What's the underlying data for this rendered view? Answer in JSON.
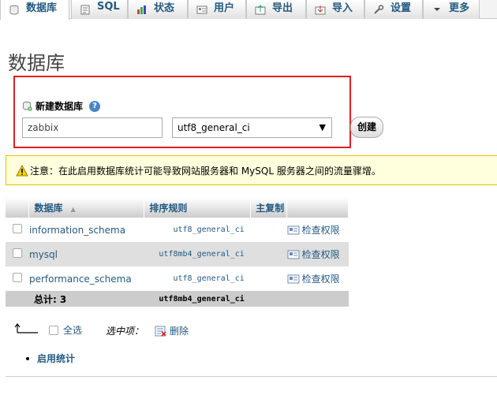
{
  "tabs": [
    {
      "label": "数据库",
      "icon": "database-icon",
      "active": true
    },
    {
      "label": "SQL",
      "icon": "sql-icon"
    },
    {
      "label": "状态",
      "icon": "status-icon"
    },
    {
      "label": "用户",
      "icon": "users-icon"
    },
    {
      "label": "导出",
      "icon": "export-icon"
    },
    {
      "label": "导入",
      "icon": "import-icon"
    },
    {
      "label": "设置",
      "icon": "settings-icon"
    },
    {
      "label": "更多",
      "icon": "chevron-down-icon"
    }
  ],
  "page_title": "数据库",
  "create": {
    "heading": "新建数据库",
    "name_value": "zabbix",
    "collation_value": "utf8_general_ci",
    "button": "创建"
  },
  "notice": "注意：在此启用数据库统计可能导致网站服务器和 MySQL 服务器之间的流量骤增。",
  "table": {
    "headers": [
      "数据库",
      "排序规则",
      "主复制"
    ],
    "rows": [
      {
        "name": "information_schema",
        "collation": "utf8_general_ci",
        "action": "检查权限"
      },
      {
        "name": "mysql",
        "collation": "utf8mb4_general_ci",
        "action": "检查权限"
      },
      {
        "name": "performance_schema",
        "collation": "utf8_general_ci",
        "action": "检查权限"
      }
    ],
    "total_label": "总计: 3",
    "total_collation": "utf8mb4_general_ci"
  },
  "bulk": {
    "select_all": "全选",
    "with_selected": "选中项：",
    "delete": "删除"
  },
  "enable_stats": "启用统计",
  "colors": {
    "link": "#235a81",
    "red_box": "#e02020",
    "notice_bg": "#ffffdd"
  }
}
